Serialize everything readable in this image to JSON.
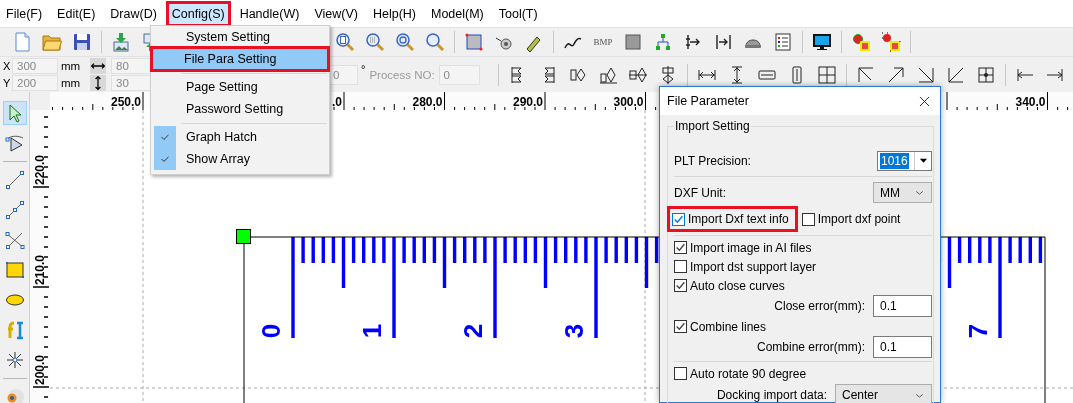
{
  "menubar": [
    {
      "label": "File(F)",
      "open": false,
      "annotated": false
    },
    {
      "label": "Edit(E)",
      "open": false,
      "annotated": false
    },
    {
      "label": "Draw(D)",
      "open": false,
      "annotated": false
    },
    {
      "label": "Config(S)",
      "open": true,
      "annotated": true
    },
    {
      "label": "Handle(W)",
      "open": false,
      "annotated": false
    },
    {
      "label": "View(V)",
      "open": false,
      "annotated": false
    },
    {
      "label": "Help(H)",
      "open": false,
      "annotated": false
    },
    {
      "label": "Model(M)",
      "open": false,
      "annotated": false
    },
    {
      "label": "Tool(T)",
      "open": false,
      "annotated": false
    }
  ],
  "config_menu": {
    "items": [
      {
        "kind": "item",
        "label": "System Setting",
        "selected": false,
        "checked": false,
        "annotated": false
      },
      {
        "kind": "item",
        "label": "File Para Setting",
        "selected": true,
        "checked": false,
        "annotated": true
      },
      {
        "kind": "separator"
      },
      {
        "kind": "item",
        "label": "Page Setting",
        "selected": false,
        "checked": false,
        "annotated": false
      },
      {
        "kind": "item",
        "label": "Password Setting",
        "selected": false,
        "checked": false,
        "annotated": false
      },
      {
        "kind": "separator"
      },
      {
        "kind": "item",
        "label": "Graph Hatch",
        "selected": false,
        "checked": true,
        "annotated": false
      },
      {
        "kind": "item",
        "label": "Show Array",
        "selected": false,
        "checked": true,
        "annotated": false
      }
    ]
  },
  "toolbar": {
    "bmp_label": "BMP"
  },
  "position_bar": {
    "rows": [
      {
        "axis": "X",
        "value": "300",
        "unit": "mm",
        "size": "80"
      },
      {
        "axis": "Y",
        "value": "200",
        "unit": "mm",
        "size": "30"
      }
    ],
    "angle": "0",
    "degree_mark": "°",
    "process": {
      "label": "Process NO:",
      "value": "0",
      "disabled": true
    }
  },
  "tools": [
    {
      "selected": true
    },
    {
      "selected": false
    },
    {
      "selected": false
    },
    {
      "selected": false
    },
    {
      "selected": false
    },
    {
      "selected": false
    },
    {
      "selected": false
    },
    {
      "selected": false
    },
    {
      "selected": false
    },
    {
      "selected": false
    }
  ],
  "horizontal_ruler": {
    "labels": [
      "250.0",
      ".0",
      "280.0",
      "290.0",
      "300.0",
      "340.0"
    ]
  },
  "vertical_ruler": {
    "labels": [
      "220.0",
      "210.0",
      "200.0"
    ]
  },
  "canvas": {
    "ruler_numbers": [
      "0",
      "1",
      "2",
      "3",
      "7"
    ]
  },
  "dialog": {
    "title": "File Parameter",
    "group": "Import Setting",
    "rows": [
      {
        "kind": "combo",
        "label": "PLT Precision:",
        "value": "1016",
        "text_selected": true
      },
      {
        "kind": "separator"
      },
      {
        "kind": "dropdown",
        "label": "DXF Unit:",
        "value": "MM"
      },
      {
        "kind": "checks",
        "items": [
          {
            "label": "Import Dxf text info",
            "checked": true,
            "focused": true,
            "annotated": true
          },
          {
            "label": "Import dxf point",
            "checked": false,
            "focused": false,
            "annotated": false
          }
        ]
      },
      {
        "kind": "separator"
      },
      {
        "kind": "check",
        "label": "Import image in AI files",
        "checked": true,
        "focused": false,
        "annotated": false
      },
      {
        "kind": "check",
        "label": "Import dst support layer",
        "checked": false,
        "focused": false,
        "annotated": false
      },
      {
        "kind": "check",
        "label": "Auto close curves",
        "checked": true,
        "focused": false,
        "annotated": false
      },
      {
        "kind": "field",
        "label": "Close error(mm):",
        "value": "0.1"
      },
      {
        "kind": "check",
        "label": "Combine lines",
        "checked": true,
        "focused": false,
        "annotated": false
      },
      {
        "kind": "field",
        "label": "Combine error(mm):",
        "value": "0.1"
      },
      {
        "kind": "separator"
      },
      {
        "kind": "check",
        "label": "Auto rotate 90 degree",
        "checked": false,
        "focused": false,
        "annotated": false
      },
      {
        "kind": "selector",
        "label": "Docking import data:",
        "value": "Center"
      }
    ]
  }
}
